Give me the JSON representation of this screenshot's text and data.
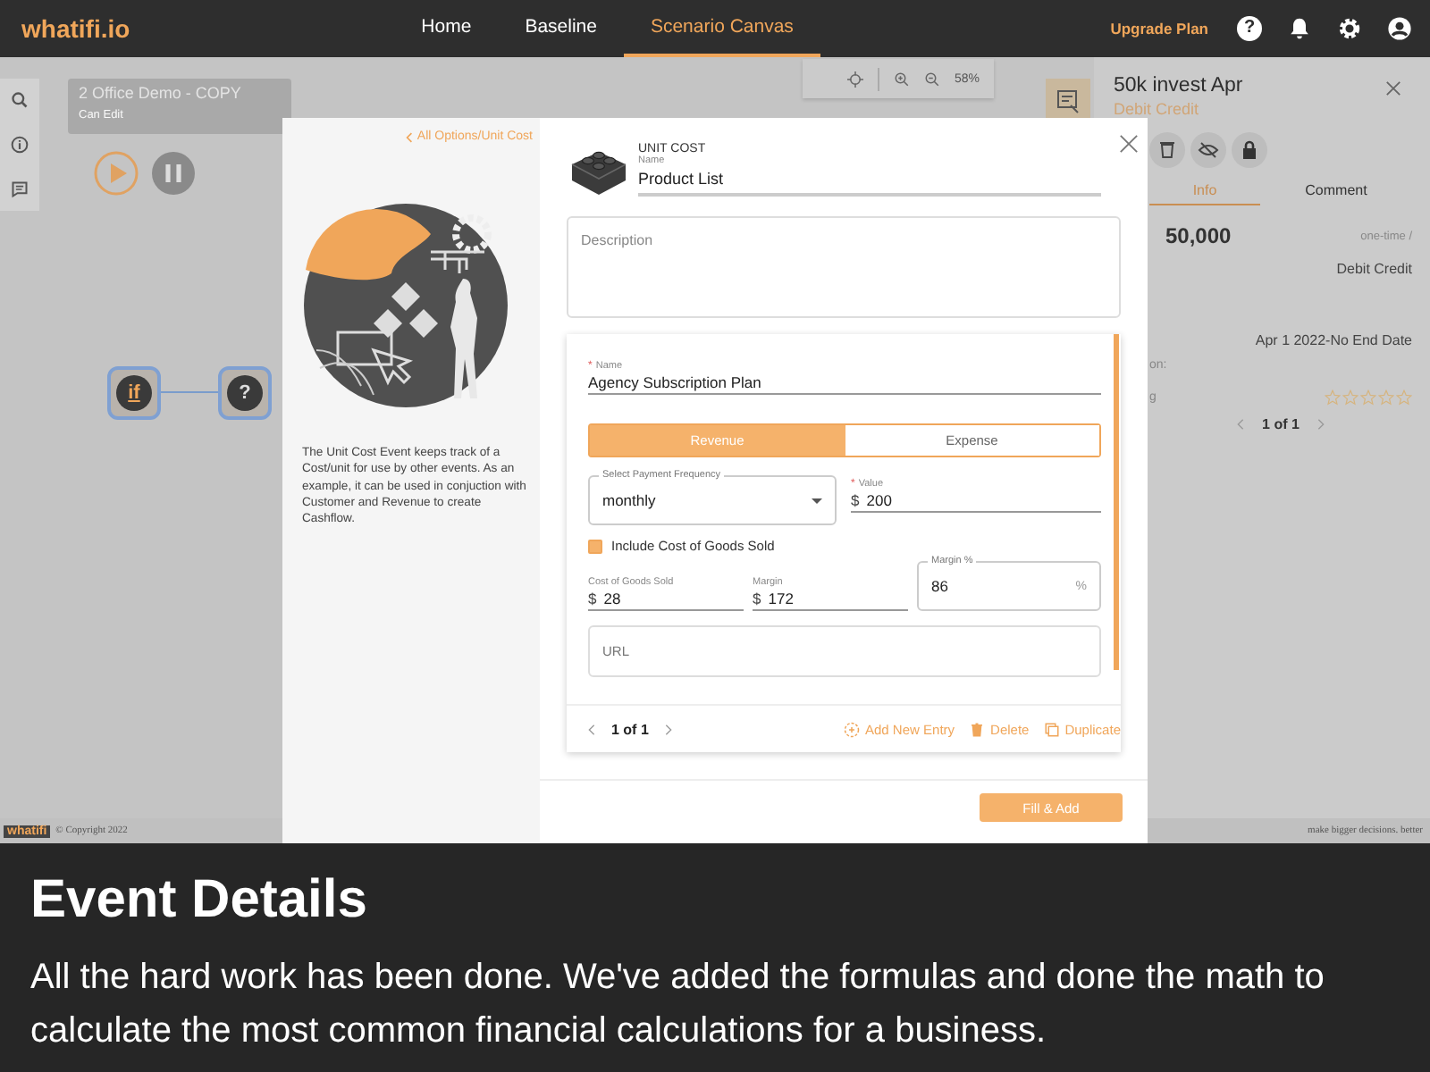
{
  "nav": {
    "logo": "whatifi.io",
    "links": [
      {
        "label": "Home",
        "selected": false
      },
      {
        "label": "Baseline",
        "selected": false
      },
      {
        "label": "Scenario Canvas",
        "selected": true
      }
    ],
    "upgrade": "Upgrade Plan",
    "help": "?"
  },
  "scenario": {
    "title": "2 Office Demo - COPY",
    "subtitle": "Can Edit"
  },
  "zoom": {
    "value": "58%"
  },
  "canvas_nodes": [
    {
      "kind": "decision",
      "label": "if"
    },
    {
      "kind": "event",
      "label": "?"
    }
  ],
  "side_panel": {
    "title": "50k invest Apr",
    "subtitle": "Debit Credit",
    "tabs": [
      {
        "label": "Info",
        "selected": true
      },
      {
        "label": "Comment",
        "selected": false
      }
    ],
    "amount": "50,000",
    "frequency": "one-time /",
    "type": "Debit Credit",
    "dates": "Apr 1 2022-No End Date",
    "label_1": "on:",
    "label_2": "g",
    "stars": 0,
    "pagination": "1 of 1"
  },
  "modal": {
    "breadcrumb": "All Options/Unit Cost",
    "about": "The Unit Cost Event keeps track of a Cost/unit for use by other events. As an example, it can be used in conjuction with Customer and Revenue to create Cashflow.",
    "event_type": "UNIT COST",
    "name_label": "Name",
    "name_value": "Product List",
    "description": {
      "placeholder": "Description"
    },
    "entry": {
      "required_mark": "*",
      "name_label": "Name",
      "name_value": "Agency Subscription Plan",
      "toggle": [
        {
          "label": "Revenue",
          "selected": true
        },
        {
          "label": "Expense",
          "selected": false
        }
      ],
      "frequency": {
        "label": "Select Payment Frequency",
        "value": "monthly"
      },
      "value": {
        "label": "Value",
        "prefix": "$",
        "value": "200"
      },
      "include_cogs": {
        "label": "Include Cost of Goods Sold",
        "checked": true
      },
      "cogs": {
        "label": "Cost of Goods Sold",
        "prefix": "$",
        "value": "28"
      },
      "margin": {
        "label": "Margin",
        "prefix": "$",
        "value": "172"
      },
      "margin_pct": {
        "label": "Margin %",
        "value": "86",
        "suffix": "%"
      },
      "url": {
        "placeholder": "URL"
      }
    },
    "pagination": "1 of 1",
    "actions": [
      {
        "kind": "add",
        "label": "Add New Entry"
      },
      {
        "kind": "delete",
        "label": "Delete"
      },
      {
        "kind": "duplicate",
        "label": "Duplicate"
      }
    ],
    "submit": "Fill & Add"
  },
  "footer": {
    "logo": "whatifi",
    "copyright": "© Copyright 2022",
    "tagline": "make bigger decisions. better"
  },
  "caption": {
    "title": "Event Details",
    "text": "All the hard work has been done. We've added the formulas and done the math to calculate the most common financial calculations for a business."
  }
}
